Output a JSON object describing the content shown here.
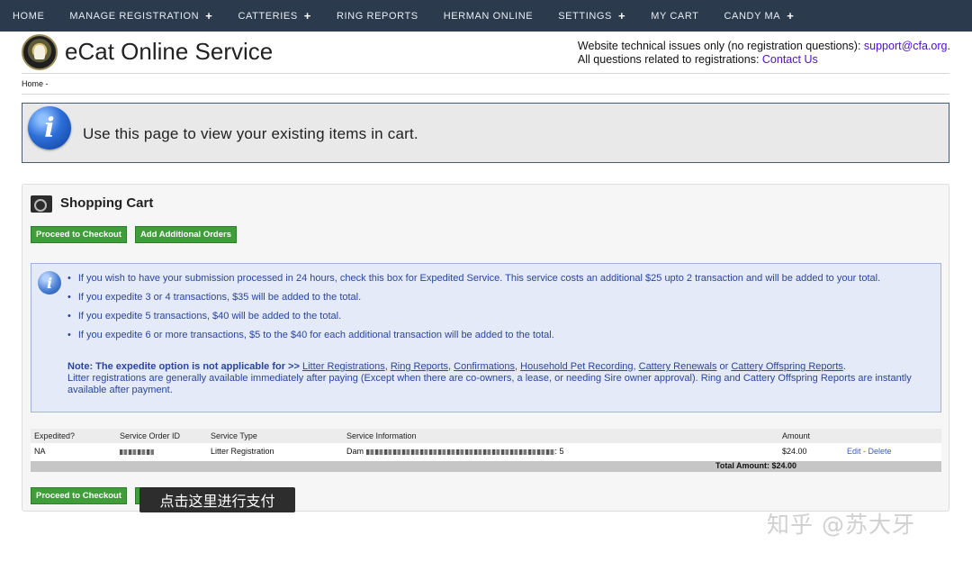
{
  "nav": {
    "items": [
      {
        "label": "HOME",
        "has_plus": false
      },
      {
        "label": "MANAGE REGISTRATION",
        "has_plus": true
      },
      {
        "label": "CATTERIES",
        "has_plus": true
      },
      {
        "label": "RING REPORTS",
        "has_plus": false
      },
      {
        "label": "HERMAN ONLINE",
        "has_plus": false
      },
      {
        "label": "SETTINGS",
        "has_plus": true
      },
      {
        "label": "MY CART",
        "has_plus": false
      },
      {
        "label": "CANDY MA",
        "has_plus": true
      }
    ],
    "plus_symbol": "+"
  },
  "header": {
    "title": "eCat Online Service",
    "contact_line1_prefix": "Website technical issues only (no registration questions): ",
    "contact_email": "support@cfa.org",
    "contact_line1_suffix": ".",
    "contact_line2_prefix": "All questions related to registrations: ",
    "contact_link": "Contact Us"
  },
  "breadcrumb": "Home -",
  "banner": {
    "icon": "info-icon",
    "text": "Use this page to view your existing items in cart."
  },
  "cart": {
    "title": "Shopping Cart",
    "icon": "cart-icon",
    "buttons": {
      "checkout": "Proceed to Checkout",
      "add_orders": "Add Additional Orders"
    },
    "notice": {
      "bullets": [
        "If you wish to have your submission processed in 24 hours, check this box for Expedited Service. This service costs an additional $25 upto 2 transaction and will be added to your total.",
        "If you expedite 3 or 4 transactions, $35 will be added to the total.",
        "If you expedite 5 transactions, $40 will be added to the total.",
        "If you expedite 6 or more transactions, $5 to the $40 for each additional transaction will be added to the total."
      ],
      "note_label": "Note: The expedite option is not applicable for >>",
      "links": [
        "Litter Registrations",
        "Ring Reports",
        "Confirmations",
        "Household Pet Recording",
        "Cattery Renewals",
        "Cattery Offspring Reports"
      ],
      "link_joiner_or": "or",
      "tail": "Litter registrations are generally available immediately after paying (Except when there are co-owners, a lease, or needing Sire owner approval). Ring and Cattery Offspring Reports are instantly available after payment."
    },
    "table": {
      "headers": [
        "Expedited?",
        "Service Order ID",
        "Service Type",
        "Service Information",
        "Amount"
      ],
      "row": {
        "expedited": "NA",
        "service_type": "Litter Registration",
        "info_prefix": "Dam",
        "info_suffix": ": 5",
        "amount": "$24.00",
        "edit": "Edit",
        "separator": "-",
        "delete": "Delete"
      },
      "total": "Total Amount: $24.00"
    }
  },
  "tooltip": "点击这里进行支付",
  "watermark": "知乎 @苏大牙"
}
